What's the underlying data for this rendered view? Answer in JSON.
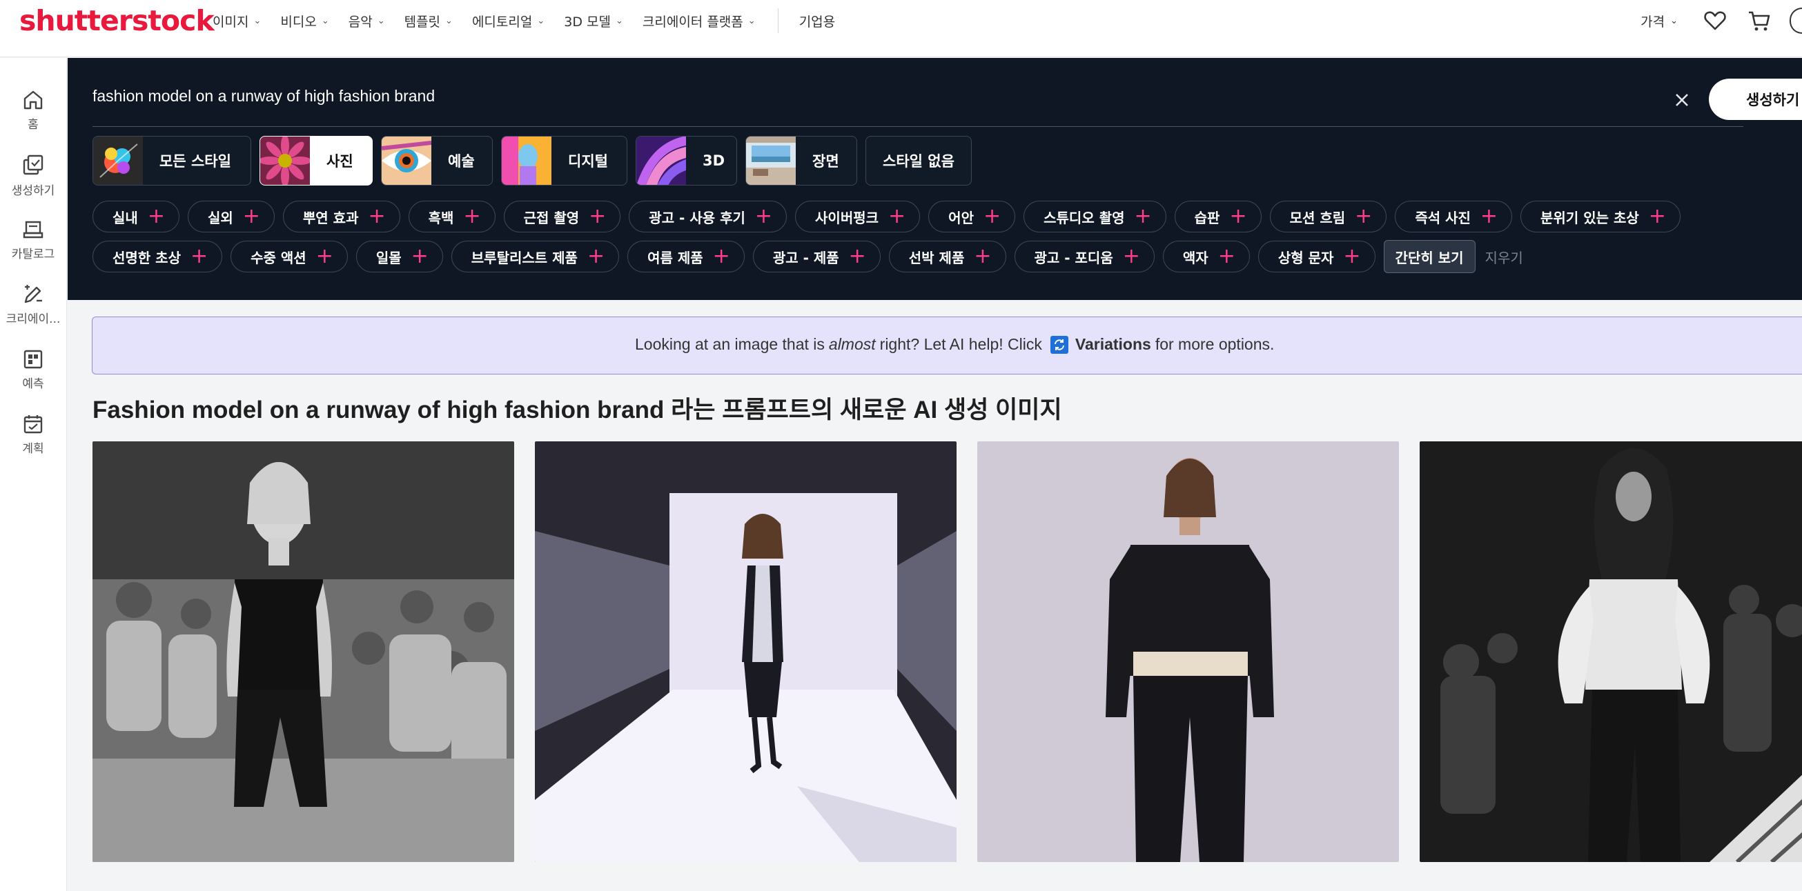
{
  "brand": {
    "logo_text": "shutterstock",
    "accent": "#e8193c"
  },
  "topnav": {
    "items": [
      {
        "label": "이미지"
      },
      {
        "label": "비디오"
      },
      {
        "label": "음악"
      },
      {
        "label": "템플릿"
      },
      {
        "label": "에디토리얼"
      },
      {
        "label": "3D 모델"
      },
      {
        "label": "크리에이터 플랫폼"
      }
    ],
    "enterprise": "기업용",
    "pricing": "가격",
    "icons": [
      "chevron-down-icon",
      "heart-icon",
      "cart-icon",
      "avatar-icon"
    ]
  },
  "rail": {
    "items": [
      {
        "label": "홈",
        "icon": "home-icon"
      },
      {
        "label": "생성하기",
        "icon": "generate-icon"
      },
      {
        "label": "카탈로그",
        "icon": "catalog-icon"
      },
      {
        "label": "크리에이...",
        "icon": "create-edit-icon"
      },
      {
        "label": "예측",
        "icon": "predict-icon"
      },
      {
        "label": "계획",
        "icon": "calendar-icon"
      }
    ]
  },
  "search": {
    "query": "fashion model on a runway of high fashion brand",
    "generate_label": "생성하기",
    "clear_icon": "close-icon",
    "panel_color": "#0f1724"
  },
  "styles": [
    {
      "label": "모든 스타일",
      "active": false
    },
    {
      "label": "사진",
      "active": true
    },
    {
      "label": "예술",
      "active": false
    },
    {
      "label": "디지털",
      "active": false
    },
    {
      "label": "3D",
      "active": false
    },
    {
      "label": "장면",
      "active": false
    },
    {
      "label": "스타일 없음",
      "active": false
    }
  ],
  "tags": {
    "row1": [
      "실내",
      "실외",
      "뿌연 효과",
      "흑백",
      "근접 촬영",
      "광고 - 사용 후기",
      "사이버펑크",
      "어안",
      "스튜디오 촬영",
      "습판",
      "모션 흐림",
      "즉석 사진",
      "분위기 있는 초상"
    ],
    "row2": [
      "선명한 초상",
      "수중 액션",
      "일몰",
      "브루탈리스트 제품",
      "여름 제품",
      "광고 - 제품",
      "선박 제품",
      "광고 - 포디움",
      "액자",
      "상형 문자"
    ],
    "show_less": "간단히 보기",
    "clear": "지우기",
    "plus_color": "#ff3d8b"
  },
  "banner": {
    "text_before": "Looking at an image that is",
    "emphasis": "almost",
    "text_middle": "right? Let AI help! Click",
    "link": "Variations",
    "text_after": "for more options.",
    "icon": "variations-icon"
  },
  "results": {
    "title": "Fashion model on a runway of high fashion brand 라는 프롬프트의 새로운 AI 생성 이미지",
    "images": [
      {
        "alt": "black and white runway model in black strapless jumpsuit"
      },
      {
        "alt": "model walking on white runway under spotlight"
      },
      {
        "alt": "model in black oversized top and wide trousers on grey background"
      },
      {
        "alt": "model with curly hair in white blouse and black pants"
      }
    ]
  }
}
